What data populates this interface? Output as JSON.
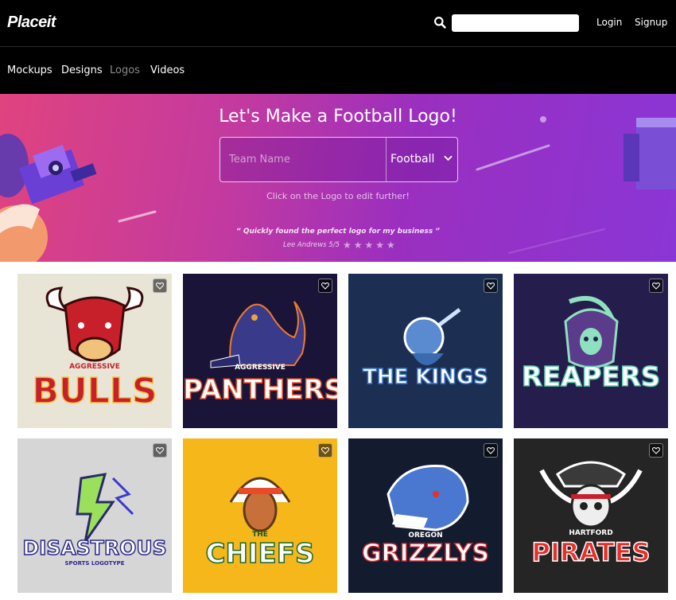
{
  "header": {
    "brand": "Placeit",
    "search_placeholder": "",
    "login": "Login",
    "signup": "Signup"
  },
  "nav": {
    "items": [
      {
        "label": "Mockups",
        "active": false
      },
      {
        "label": "Designs",
        "active": false
      },
      {
        "label": "Logos",
        "active": true
      },
      {
        "label": "Videos",
        "active": false
      }
    ]
  },
  "hero": {
    "title": "Let's Make a Football Logo!",
    "team_placeholder": "Team Name",
    "sport_selected": "Football",
    "hint": "Click on the Logo to edit further!",
    "quote": "“ Quickly found the perfect logo for my business ”",
    "author": "Lee Andrews 5/5",
    "rating": 5
  },
  "logos": [
    {
      "top": "AGGRESSIVE",
      "name": "BULLS",
      "bg": "#e8e5d6",
      "mascot": "bull"
    },
    {
      "top": "AGGRESSIVE",
      "name": "PANTHERS",
      "bg": "#1a1538",
      "mascot": "panther"
    },
    {
      "top": "",
      "name": "THE KINGS",
      "bg": "#1c2f52",
      "mascot": "knight"
    },
    {
      "top": "",
      "name": "REAPERS",
      "bg": "#251e4d",
      "mascot": "reaper"
    },
    {
      "top": "",
      "name": "DISASTROUS",
      "sub": "SPORTS LOGOTYPE",
      "bg": "#d6d6d6",
      "mascot": "lightning"
    },
    {
      "top": "THE",
      "name": "CHIEFS",
      "bg": "#f5b71a",
      "mascot": "chief"
    },
    {
      "top": "OREGON",
      "name": "GRIZZLYS",
      "bg": "#131b2e",
      "mascot": "bear"
    },
    {
      "top": "HARTFORD",
      "name": "PIRATES",
      "bg": "#252525",
      "mascot": "pirate"
    }
  ],
  "colors": {
    "hero_start": "#e0437f",
    "hero_end": "#8a36d6"
  },
  "icons": {
    "search": "search-icon",
    "favorite": "heart-icon",
    "dropdown": "chevron-down-icon",
    "star": "star-icon"
  }
}
